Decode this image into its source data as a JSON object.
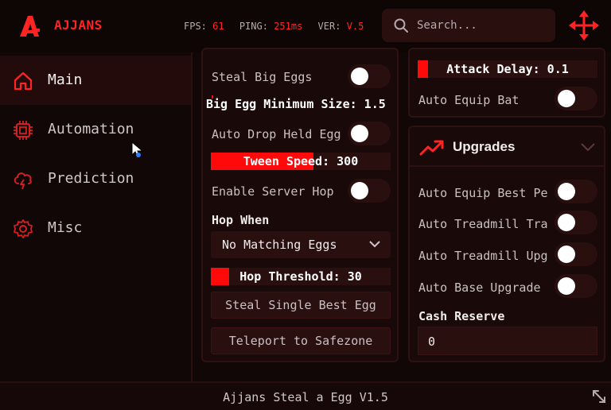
{
  "header": {
    "brand": "AJJANS",
    "stats": {
      "fps_label": "FPS:",
      "fps_value": "61",
      "ping_label": "PING:",
      "ping_value": "251ms",
      "ver_label": "VER:",
      "ver_value": "V.5"
    },
    "search_placeholder": "Search...",
    "icons": {
      "logo": "a-logo-icon",
      "search": "search-icon",
      "move": "move-icon"
    }
  },
  "sidebar": {
    "items": [
      {
        "label": "Main",
        "icon": "home-icon",
        "active": true
      },
      {
        "label": "Automation",
        "icon": "chip-icon",
        "active": false
      },
      {
        "label": "Prediction",
        "icon": "cloud-lightning-icon",
        "active": false
      },
      {
        "label": "Misc",
        "icon": "gear-icon",
        "active": false
      }
    ]
  },
  "left_panel": {
    "steal_big_eggs": {
      "label": "Steal Big Eggs",
      "on": false
    },
    "big_egg_min_size": {
      "label": "Big Egg Minimum Size: 1.5",
      "fill": 0.0
    },
    "auto_drop_held_egg": {
      "label": "Auto Drop Held Egg",
      "on": false
    },
    "tween_speed": {
      "label": "Tween Speed: 300",
      "fill": 0.57
    },
    "enable_server_hop": {
      "label": "Enable Server Hop",
      "on": false
    },
    "hop_when": {
      "label": "Hop When",
      "selected": "No Matching Eggs"
    },
    "hop_threshold": {
      "label": "Hop Threshold: 30",
      "fill": 0.1
    },
    "steal_single_best_egg": "Steal Single Best Egg",
    "teleport_to_safezone": "Teleport to Safezone"
  },
  "right_top_panel": {
    "attack_delay": {
      "label": "Attack Delay: 0.1",
      "fill": 0.06
    },
    "auto_equip_bat": {
      "label": "Auto Equip Bat",
      "on": false
    }
  },
  "upgrades_panel": {
    "title": "Upgrades",
    "icon": "trending-up-icon",
    "auto_equip_best_pet": {
      "label": "Auto Equip Best Pe",
      "on": false
    },
    "auto_treadmill_train": {
      "label": "Auto Treadmill Tra",
      "on": false
    },
    "auto_treadmill_upgrade": {
      "label": "Auto Treadmill Upg",
      "on": false
    },
    "auto_base_upgrade": {
      "label": "Auto Base Upgrade",
      "on": false
    },
    "cash_reserve": {
      "label": "Cash Reserve",
      "value": "0"
    }
  },
  "footer": {
    "title": "Ajjans Steal a Egg V1.5"
  },
  "colors": {
    "accent": "#ff0a0a",
    "background": "#120707",
    "panel": "#1a0909",
    "control": "#2a0f0f"
  }
}
